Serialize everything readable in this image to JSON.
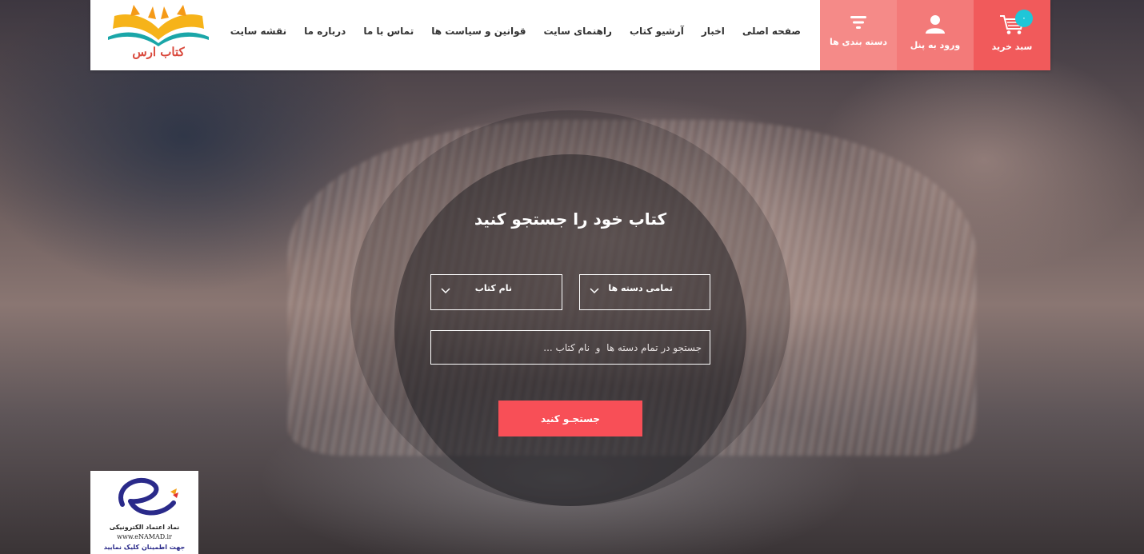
{
  "header": {
    "logo_text": "کتاب ارس",
    "nav": [
      "صفحه اصلی",
      "اخبار",
      "آرشیو کتاب",
      "راهنمای سایت",
      "قوانین و سیاست ها",
      "تماس با ما",
      "درباره ما",
      "نقشه سایت"
    ],
    "cart": {
      "label": "سبد خرید",
      "count": "۰",
      "icon": "cart-icon"
    },
    "login": {
      "label": "ورود به پنل",
      "icon": "user-icon"
    },
    "categories": {
      "label": "دسته بندی ها",
      "icon": "filter-icon"
    }
  },
  "search": {
    "title": "کتاب خود را جستجو کنید",
    "category_select": "تمامی دسته ها",
    "field_select": "نام کتاب",
    "placeholder": "جستجو در تمام دسته ها  و  نام کتاب ...",
    "button": "جستجـو کنید"
  },
  "enamad": {
    "line1": "نماد اعتماد الکترونیکی",
    "line2": "www.eNAMAD.ir",
    "line3": "جهت اطمینان کلیک نمایید"
  },
  "colors": {
    "accent": "#f84f57",
    "cart_bg": "#f15a5b",
    "badge": "#1fc6d8"
  }
}
